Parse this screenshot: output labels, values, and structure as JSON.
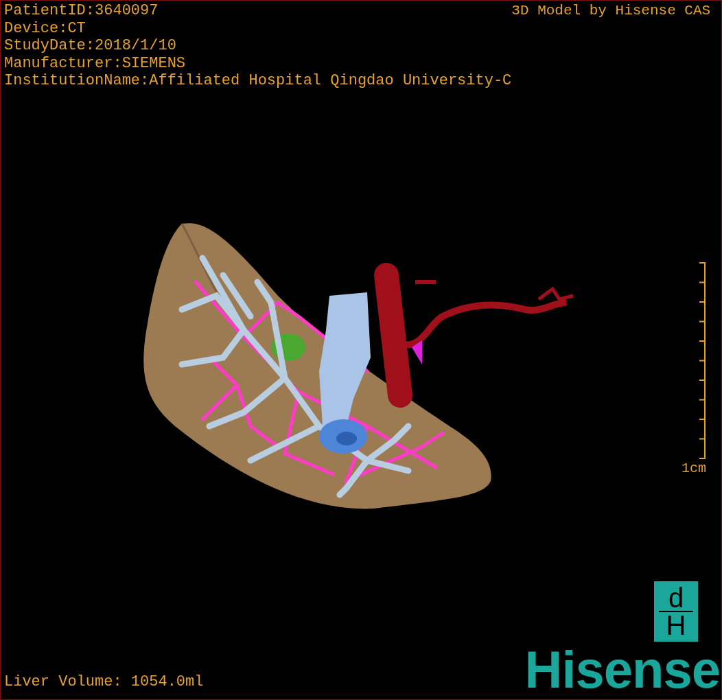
{
  "info_lines": [
    "PatientID:3640097",
    "Device:CT",
    "StudyDate:2018/1/10",
    "Manufacturer:SIEMENS",
    "InstitutionName:Affiliated Hospital Qingdao University-C"
  ],
  "model_title": "3D Model by Hisense CAS",
  "scale_bar": {
    "label": "1cm"
  },
  "measurement": "Liver Volume: 1054.0ml",
  "logo": {
    "mark_top": "d",
    "mark_bottom": "H",
    "wordmark": "Hisense"
  }
}
